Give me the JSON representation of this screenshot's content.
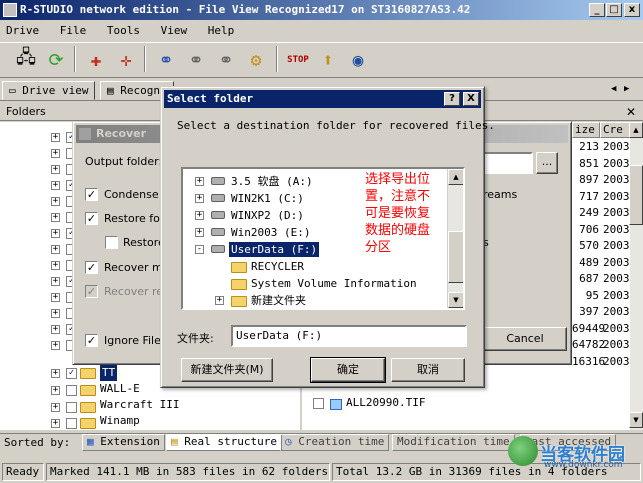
{
  "window": {
    "title": "R-STUDIO network edition - File View Recognized17 on ST3160827AS3.42"
  },
  "menu": [
    "Drive",
    "File",
    "Tools",
    "View",
    "Help"
  ],
  "tabs": [
    "Drive view",
    "Recogni"
  ],
  "folders_panel": {
    "title": "Folders"
  },
  "file_columns": [
    "ize",
    "Cre"
  ],
  "file_rows": [
    {
      "size": "213",
      "date": "2003"
    },
    {
      "size": "851",
      "date": "2003"
    },
    {
      "size": "897",
      "date": "2003"
    },
    {
      "size": "717",
      "date": "2003"
    },
    {
      "size": "249",
      "date": "2003"
    },
    {
      "size": "706",
      "date": "2003"
    },
    {
      "size": "570",
      "date": "2003"
    },
    {
      "size": "489",
      "date": "2003"
    },
    {
      "size": "687",
      "date": "2003"
    },
    {
      "size": "95",
      "date": "2003"
    },
    {
      "size": "397",
      "date": "2003"
    },
    {
      "size": "69449",
      "date": "2003"
    },
    {
      "size": "64782",
      "date": "2003"
    },
    {
      "size": "16316",
      "date": "2003"
    }
  ],
  "file_row_name": "ALL20990.TIF",
  "tree_bottom": [
    "TT",
    "WALL-E",
    "Warcraft III",
    "Winamp"
  ],
  "recover_dialog": {
    "title": "Recover",
    "output_folder_label": "Output folder:",
    "browse_label": "...",
    "options": [
      {
        "label": "Condense s",
        "checked": true
      },
      {
        "label": "Restore fold",
        "checked": true
      },
      {
        "label": "Restore",
        "checked": false
      },
      {
        "label": "Recover me",
        "checked": true
      },
      {
        "label": "Recover rea",
        "checked": true
      },
      {
        "label": "Ignore File M",
        "checked": true
      }
    ],
    "right_fragments": [
      "reams",
      "s"
    ],
    "cancel_label": "Cancel"
  },
  "select_folder_dialog": {
    "title": "Select folder",
    "help_btn": "?",
    "close_btn": "X",
    "prompt": "Select a destination folder for recovered files.",
    "tree": [
      {
        "label": "3.5 软盘 (A:)",
        "kind": "floppy",
        "expander": "+",
        "indent": 0
      },
      {
        "label": "WIN2K1 (C:)",
        "kind": "drive",
        "expander": "+",
        "indent": 0
      },
      {
        "label": "WINXP2 (D:)",
        "kind": "drive",
        "expander": "+",
        "indent": 0
      },
      {
        "label": "Win2003 (E:)",
        "kind": "drive",
        "expander": "+",
        "indent": 0
      },
      {
        "label": "UserData (F:)",
        "kind": "drive",
        "expander": "-",
        "indent": 0,
        "selected": true
      },
      {
        "label": "RECYCLER",
        "kind": "folder",
        "expander": "",
        "indent": 1
      },
      {
        "label": "System Volume Information",
        "kind": "folder",
        "expander": "",
        "indent": 1
      },
      {
        "label": "新建文件夹",
        "kind": "folder",
        "expander": "+",
        "indent": 1
      }
    ],
    "annotation": [
      "选择导出位",
      "置，注意不",
      "可是要恢复",
      "数据的硬盘",
      "分区"
    ],
    "folder_label": "文件夹:",
    "folder_value": "UserData (F:)",
    "new_folder_btn": "新建文件夹(M)",
    "ok_btn": "确定",
    "cancel_btn": "取消"
  },
  "sort_bar": {
    "label": "Sorted by:",
    "tabs": [
      "Extension",
      "Real structure",
      "Creation time",
      "Modification time",
      "Last accessed"
    ]
  },
  "status": {
    "ready": "Ready",
    "marked": "Marked 141.1 MB in 583 files in 62 folders",
    "total": "Total 13.2 GB in 31369 files in 4 folders"
  },
  "watermark": {
    "text": "当客软件园",
    "url": "www.downkr.com"
  }
}
